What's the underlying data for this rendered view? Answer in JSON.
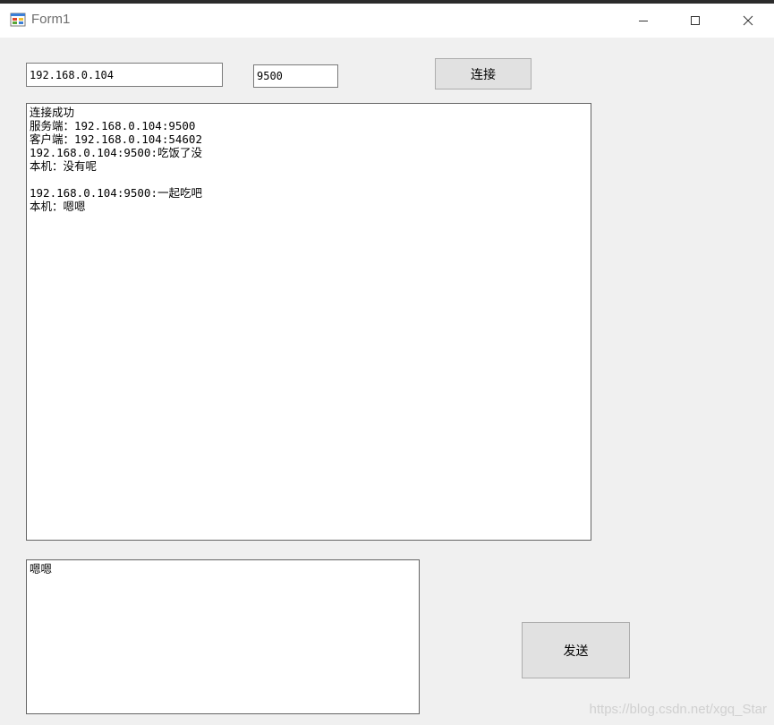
{
  "window": {
    "title": "Form1",
    "minimize_icon": "minimize-icon",
    "maximize_icon": "maximize-icon",
    "close_icon": "close-icon"
  },
  "connection": {
    "ip_value": "192.168.0.104",
    "port_value": "9500",
    "connect_label": "连接"
  },
  "log": {
    "lines": [
      "连接成功",
      "服务端：192.168.0.104:9500",
      "客户端：192.168.0.104:54602",
      "192.168.0.104:9500:吃饭了没",
      "本机：没有呢",
      "",
      "192.168.0.104:9500:一起吃吧",
      "本机：嗯嗯"
    ]
  },
  "message": {
    "value": "嗯嗯",
    "send_label": "发送"
  },
  "watermark": "https://blog.csdn.net/xgq_Star"
}
